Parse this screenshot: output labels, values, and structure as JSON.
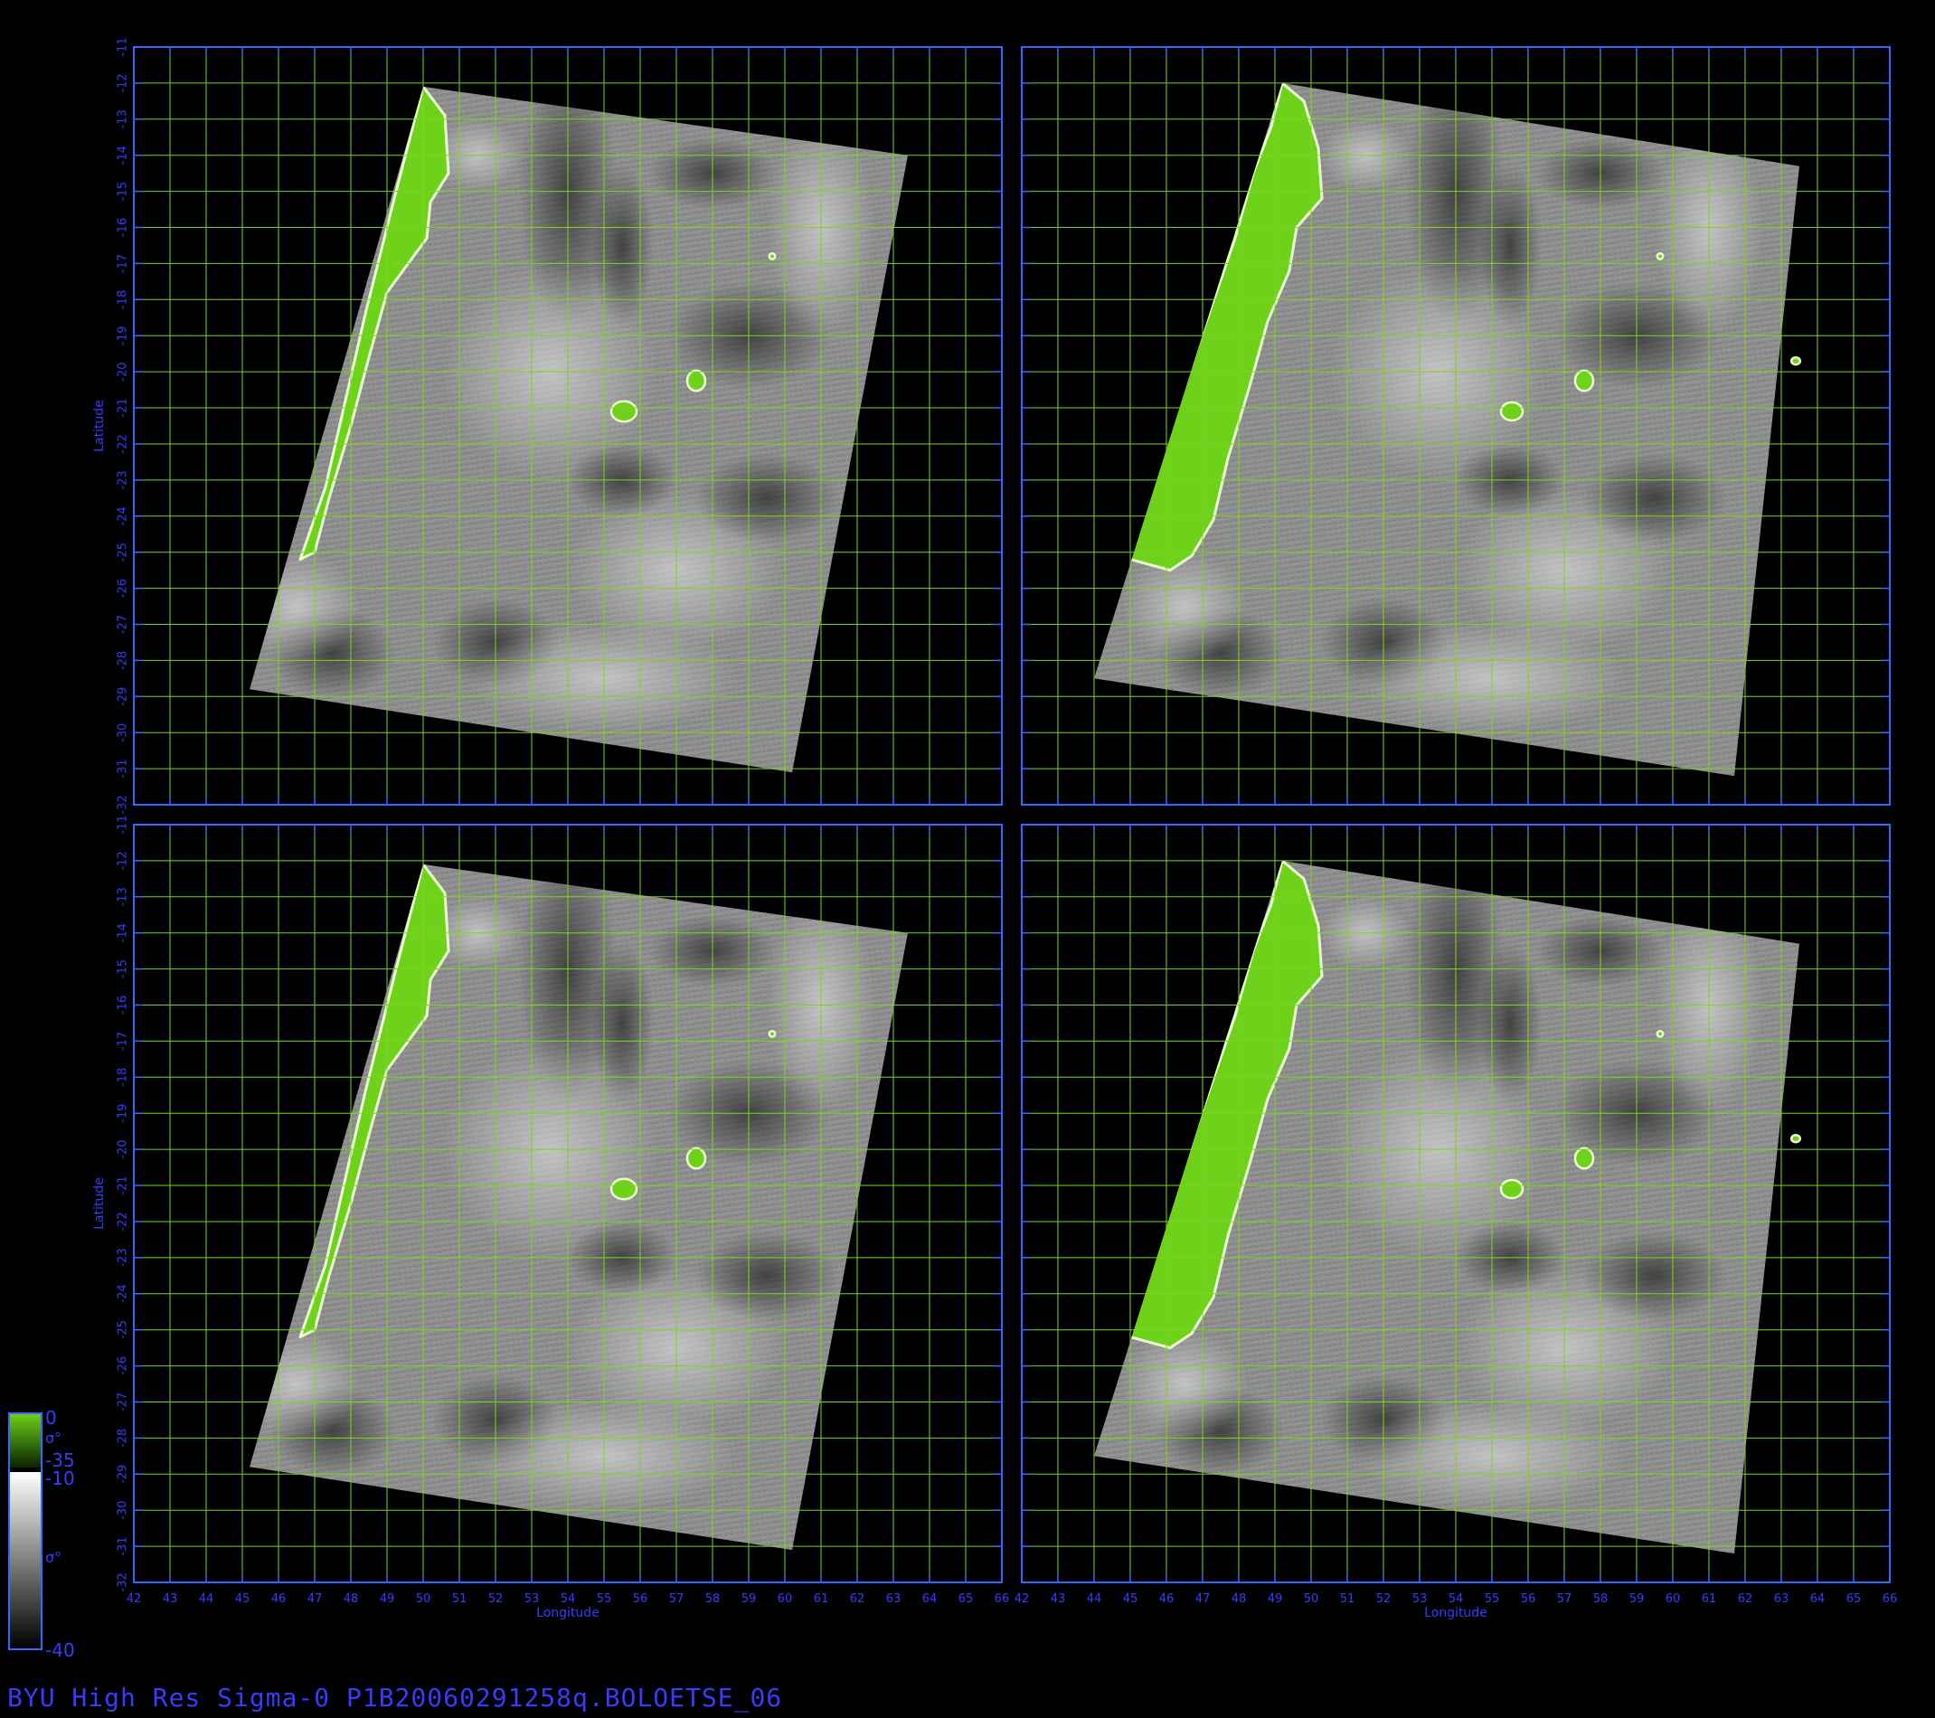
{
  "title": "BYU High Res Sigma-0 P1B20060291258q.BOLOETSE_06",
  "colors": {
    "background": "#000000",
    "axis": "#2f6bff",
    "axis_text": "#3a3aff",
    "grid": "#7ed321",
    "land": "#6fd21a",
    "land_edge": "#e8ffd0",
    "gray_mid": "#8a8a8a"
  },
  "axes": {
    "x_label": "Longitude",
    "y_label": "Latitude",
    "x_range": [
      42,
      66
    ],
    "y_range": [
      -32,
      -11
    ],
    "x_ticks": [
      "42",
      "43",
      "44",
      "45",
      "46",
      "47",
      "48",
      "49",
      "50",
      "51",
      "52",
      "53",
      "54",
      "55",
      "56",
      "57",
      "58",
      "59",
      "60",
      "61",
      "62",
      "63",
      "64",
      "65",
      "66"
    ],
    "y_ticks": [
      "-11",
      "-12",
      "-13",
      "-14",
      "-15",
      "-16",
      "-17",
      "-18",
      "-19",
      "-20",
      "-21",
      "-22",
      "-23",
      "-24",
      "-25",
      "-26",
      "-27",
      "-28",
      "-29",
      "-30",
      "-31",
      "-32"
    ]
  },
  "panels": [
    {
      "name": "top-left",
      "swath": [
        [
          50.0,
          -12.1
        ],
        [
          63.4,
          -14.0
        ],
        [
          60.2,
          -31.1
        ],
        [
          45.2,
          -28.8
        ]
      ],
      "land": [
        [
          50.0,
          -12.1
        ],
        [
          50.6,
          -12.9
        ],
        [
          50.7,
          -14.5
        ],
        [
          50.2,
          -15.3
        ],
        [
          50.1,
          -16.3
        ],
        [
          49.0,
          -17.8
        ],
        [
          48.5,
          -19.6
        ],
        [
          48.0,
          -21.5
        ],
        [
          47.4,
          -23.5
        ],
        [
          47.0,
          -25.0
        ],
        [
          46.6,
          -25.2
        ],
        [
          47.3,
          -23.2
        ],
        [
          48.4,
          -18.4
        ],
        [
          49.2,
          -15.2
        ]
      ],
      "islands": [
        {
          "lon": 55.55,
          "lat": -21.1,
          "rx": 0.35,
          "ry": 0.28
        },
        {
          "lon": 57.55,
          "lat": -20.25,
          "rx": 0.25,
          "ry": 0.28
        },
        {
          "lon": 59.65,
          "lat": -16.8,
          "rx": 0.08,
          "ry": 0.08
        }
      ]
    },
    {
      "name": "top-right",
      "swath": [
        [
          49.2,
          -12.0
        ],
        [
          63.5,
          -14.3
        ],
        [
          61.7,
          -31.2
        ],
        [
          44.0,
          -28.5
        ]
      ],
      "land": [
        [
          49.2,
          -12.0
        ],
        [
          49.8,
          -12.5
        ],
        [
          50.2,
          -13.8
        ],
        [
          50.3,
          -15.2
        ],
        [
          49.6,
          -16.0
        ],
        [
          49.4,
          -17.2
        ],
        [
          48.8,
          -18.6
        ],
        [
          48.3,
          -20.4
        ],
        [
          47.7,
          -22.4
        ],
        [
          47.3,
          -24.1
        ],
        [
          46.7,
          -25.1
        ],
        [
          46.1,
          -25.5
        ],
        [
          45.0,
          -25.2
        ],
        [
          45.3,
          -24.0
        ],
        [
          46.0,
          -22.0
        ],
        [
          46.9,
          -19.2
        ],
        [
          47.9,
          -16.3
        ],
        [
          48.4,
          -14.5
        ],
        [
          48.9,
          -13.2
        ]
      ],
      "islands": [
        {
          "lon": 55.55,
          "lat": -21.1,
          "rx": 0.3,
          "ry": 0.25
        },
        {
          "lon": 57.55,
          "lat": -20.25,
          "rx": 0.25,
          "ry": 0.28
        },
        {
          "lon": 63.4,
          "lat": -19.7,
          "rx": 0.12,
          "ry": 0.1
        },
        {
          "lon": 59.65,
          "lat": -16.8,
          "rx": 0.08,
          "ry": 0.08
        }
      ]
    },
    {
      "name": "bottom-left",
      "swath": [
        [
          50.0,
          -12.1
        ],
        [
          63.4,
          -14.0
        ],
        [
          60.2,
          -31.1
        ],
        [
          45.2,
          -28.8
        ]
      ],
      "land": [
        [
          50.0,
          -12.1
        ],
        [
          50.6,
          -12.9
        ],
        [
          50.7,
          -14.5
        ],
        [
          50.2,
          -15.3
        ],
        [
          50.1,
          -16.3
        ],
        [
          49.0,
          -17.8
        ],
        [
          48.5,
          -19.6
        ],
        [
          48.0,
          -21.5
        ],
        [
          47.4,
          -23.5
        ],
        [
          47.0,
          -25.0
        ],
        [
          46.6,
          -25.2
        ],
        [
          47.3,
          -23.2
        ],
        [
          48.4,
          -18.4
        ],
        [
          49.2,
          -15.2
        ]
      ],
      "islands": [
        {
          "lon": 55.55,
          "lat": -21.1,
          "rx": 0.35,
          "ry": 0.28
        },
        {
          "lon": 57.55,
          "lat": -20.25,
          "rx": 0.25,
          "ry": 0.28
        },
        {
          "lon": 59.65,
          "lat": -16.8,
          "rx": 0.08,
          "ry": 0.08
        }
      ]
    },
    {
      "name": "bottom-right",
      "swath": [
        [
          49.2,
          -12.0
        ],
        [
          63.5,
          -14.3
        ],
        [
          61.7,
          -31.2
        ],
        [
          44.0,
          -28.5
        ]
      ],
      "land": [
        [
          49.2,
          -12.0
        ],
        [
          49.8,
          -12.5
        ],
        [
          50.2,
          -13.8
        ],
        [
          50.3,
          -15.2
        ],
        [
          49.6,
          -16.0
        ],
        [
          49.4,
          -17.2
        ],
        [
          48.8,
          -18.6
        ],
        [
          48.3,
          -20.4
        ],
        [
          47.7,
          -22.4
        ],
        [
          47.3,
          -24.1
        ],
        [
          46.7,
          -25.1
        ],
        [
          46.1,
          -25.5
        ],
        [
          45.0,
          -25.2
        ],
        [
          45.3,
          -24.0
        ],
        [
          46.0,
          -22.0
        ],
        [
          46.9,
          -19.2
        ],
        [
          47.9,
          -16.3
        ],
        [
          48.4,
          -14.5
        ],
        [
          48.9,
          -13.2
        ]
      ],
      "islands": [
        {
          "lon": 55.55,
          "lat": -21.1,
          "rx": 0.3,
          "ry": 0.25
        },
        {
          "lon": 57.55,
          "lat": -20.25,
          "rx": 0.25,
          "ry": 0.28
        },
        {
          "lon": 63.4,
          "lat": -19.7,
          "rx": 0.12,
          "ry": 0.1
        },
        {
          "lon": 59.65,
          "lat": -16.8,
          "rx": 0.08,
          "ry": 0.08
        }
      ]
    }
  ],
  "colorbar": {
    "land_max": "0",
    "land_min": "-35",
    "ocean_max": "-10",
    "ocean_min": "-40",
    "symbol": "σ°"
  }
}
